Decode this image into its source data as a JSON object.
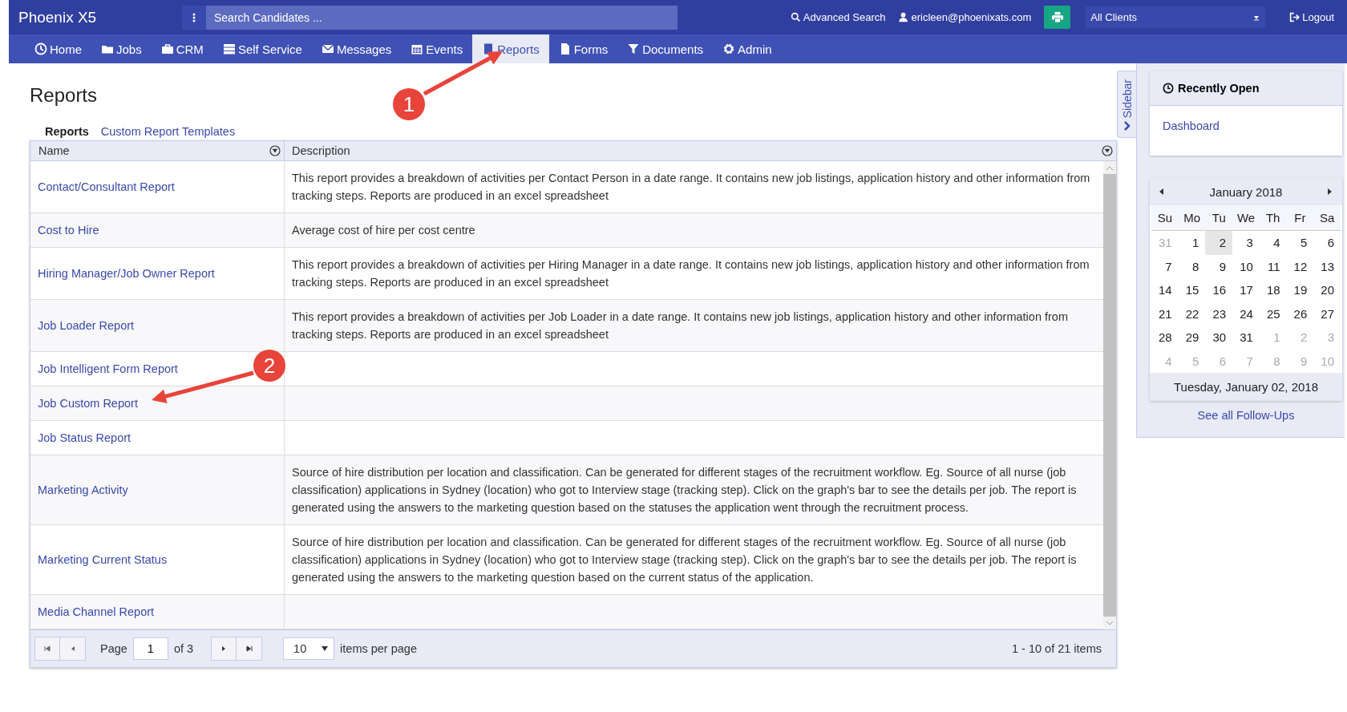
{
  "app": {
    "title": "Phoenix X5"
  },
  "search": {
    "placeholder": "Search Candidates ..."
  },
  "header_links": [
    {
      "kind": "search",
      "label": "Advanced Search"
    },
    {
      "kind": "user",
      "label": "ericleen@phoenixats.com"
    }
  ],
  "client_select": {
    "value": "All Clients"
  },
  "logout": {
    "label": "Logout"
  },
  "nav": [
    {
      "label": "Home",
      "selected": false
    },
    {
      "label": "Jobs",
      "selected": false
    },
    {
      "label": "CRM",
      "selected": false
    },
    {
      "label": "Self Service",
      "selected": false
    },
    {
      "label": "Messages",
      "selected": false
    },
    {
      "label": "Events",
      "selected": false
    },
    {
      "label": "Reports",
      "selected": true
    },
    {
      "label": "Forms",
      "selected": false
    },
    {
      "label": "Documents",
      "selected": false
    },
    {
      "label": "Admin",
      "selected": false
    }
  ],
  "page": {
    "title": "Reports"
  },
  "subtabs": [
    {
      "label": "Reports",
      "selected": true
    },
    {
      "label": "Custom Report Templates",
      "selected": false
    }
  ],
  "table": {
    "columns": [
      "Name",
      "Description"
    ],
    "rows": [
      {
        "name": "Contact/Consultant Report",
        "description": "This report provides a breakdown of activities per Contact Person in a date range. It contains new job listings, application history and other information from tracking steps. Reports are produced in an excel spreadsheet"
      },
      {
        "name": "Cost to Hire",
        "description": "Average cost of hire per cost centre"
      },
      {
        "name": "Hiring Manager/Job Owner Report",
        "description": "This report provides a breakdown of activities per Hiring Manager in a date range. It contains new job listings, application history and other information from tracking steps. Reports are produced in an excel spreadsheet"
      },
      {
        "name": "Job Loader Report",
        "description": "This report provides a breakdown of activities per Job Loader in a date range. It contains new job listings, application history and other information from tracking steps. Reports are produced in an excel spreadsheet"
      },
      {
        "name": "Job Intelligent Form Report",
        "description": ""
      },
      {
        "name": "Job Custom Report",
        "description": ""
      },
      {
        "name": "Job Status Report",
        "description": ""
      },
      {
        "name": "Marketing Activity",
        "description": "Source of hire distribution per location and classification. Can be generated for different stages of the recruitment workflow. Eg. Source of all nurse (job classification) applications in Sydney (location) who got to Interview stage (tracking step). Click on the graph's bar to see the details per job. The report is generated using the answers to the marketing question based on the statuses the application went through the recruitment process."
      },
      {
        "name": "Marketing Current Status",
        "description": "Source of hire distribution per location and classification. Can be generated for different stages of the recruitment workflow. Eg. Source of all nurse (job classification) applications in Sydney (location) who got to Interview stage (tracking step). Click on the graph's bar to see the details per job. The report is generated using the answers to the marketing question based on the current status of the application."
      },
      {
        "name": "Media Channel Report",
        "description": ""
      }
    ]
  },
  "pager": {
    "page_label": "Page",
    "page": "1",
    "of": "of 3",
    "per_page": "10",
    "per_page_label": "items per page",
    "summary": "1 - 10 of 21 items"
  },
  "sidebar_tab": {
    "label": "Sidebar"
  },
  "recent": {
    "title": "Recently Open",
    "items": [
      "Dashboard"
    ]
  },
  "calendar": {
    "month": "January 2018",
    "weekdays": [
      "Su",
      "Mo",
      "Tu",
      "We",
      "Th",
      "Fr",
      "Sa"
    ],
    "days": [
      {
        "d": "31",
        "other": true,
        "selected": false
      },
      {
        "d": "1",
        "other": false,
        "selected": false
      },
      {
        "d": "2",
        "other": false,
        "selected": true
      },
      {
        "d": "3",
        "other": false,
        "selected": false
      },
      {
        "d": "4",
        "other": false,
        "selected": false
      },
      {
        "d": "5",
        "other": false,
        "selected": false
      },
      {
        "d": "6",
        "other": false,
        "selected": false
      },
      {
        "d": "7",
        "other": false,
        "selected": false
      },
      {
        "d": "8",
        "other": false,
        "selected": false
      },
      {
        "d": "9",
        "other": false,
        "selected": false
      },
      {
        "d": "10",
        "other": false,
        "selected": false
      },
      {
        "d": "11",
        "other": false,
        "selected": false
      },
      {
        "d": "12",
        "other": false,
        "selected": false
      },
      {
        "d": "13",
        "other": false,
        "selected": false
      },
      {
        "d": "14",
        "other": false,
        "selected": false
      },
      {
        "d": "15",
        "other": false,
        "selected": false
      },
      {
        "d": "16",
        "other": false,
        "selected": false
      },
      {
        "d": "17",
        "other": false,
        "selected": false
      },
      {
        "d": "18",
        "other": false,
        "selected": false
      },
      {
        "d": "19",
        "other": false,
        "selected": false
      },
      {
        "d": "20",
        "other": false,
        "selected": false
      },
      {
        "d": "21",
        "other": false,
        "selected": false
      },
      {
        "d": "22",
        "other": false,
        "selected": false
      },
      {
        "d": "23",
        "other": false,
        "selected": false
      },
      {
        "d": "24",
        "other": false,
        "selected": false
      },
      {
        "d": "25",
        "other": false,
        "selected": false
      },
      {
        "d": "26",
        "other": false,
        "selected": false
      },
      {
        "d": "27",
        "other": false,
        "selected": false
      },
      {
        "d": "28",
        "other": false,
        "selected": false
      },
      {
        "d": "29",
        "other": false,
        "selected": false
      },
      {
        "d": "30",
        "other": false,
        "selected": false
      },
      {
        "d": "31",
        "other": false,
        "selected": false
      },
      {
        "d": "1",
        "other": true,
        "selected": false
      },
      {
        "d": "2",
        "other": true,
        "selected": false
      },
      {
        "d": "3",
        "other": true,
        "selected": false
      },
      {
        "d": "4",
        "other": true,
        "selected": false
      },
      {
        "d": "5",
        "other": true,
        "selected": false
      },
      {
        "d": "6",
        "other": true,
        "selected": false
      },
      {
        "d": "7",
        "other": true,
        "selected": false
      },
      {
        "d": "8",
        "other": true,
        "selected": false
      },
      {
        "d": "9",
        "other": true,
        "selected": false
      },
      {
        "d": "10",
        "other": true,
        "selected": false
      }
    ],
    "footer": "Tuesday, January 02, 2018"
  },
  "follow_ups": {
    "label": "See all Follow-Ups"
  },
  "annotations": [
    {
      "number": "1"
    },
    {
      "number": "2"
    }
  ]
}
